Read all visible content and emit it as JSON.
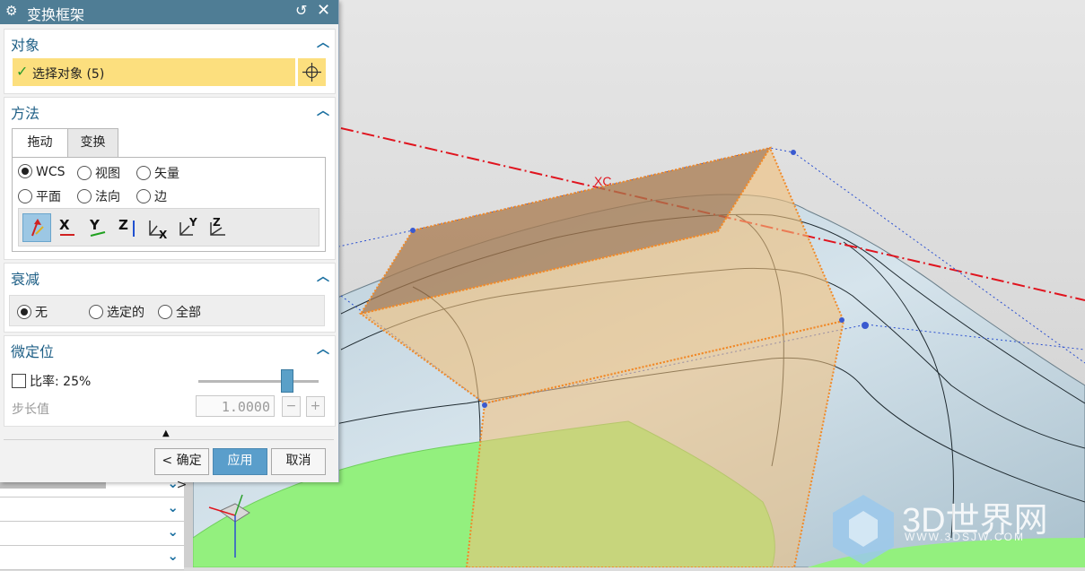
{
  "dialog": {
    "title": "变换框架",
    "sections": {
      "object": {
        "title": "对象",
        "select_label": "选择对象 (5)"
      },
      "method": {
        "title": "方法",
        "tabs": [
          "拖动",
          "变换"
        ],
        "active_tab": "拖动",
        "options_row1": [
          "WCS",
          "视图",
          "矢量"
        ],
        "options_row2": [
          "平面",
          "法向",
          "边"
        ],
        "selected_option": "WCS",
        "axis_buttons": [
          "X",
          "Y",
          "Z"
        ]
      },
      "attenuation": {
        "title": "衰减",
        "options": [
          "无",
          "选定的",
          "全部"
        ],
        "selected": "无"
      },
      "fine_positioning": {
        "title": "微定位",
        "ratio_label": "比率:",
        "ratio_value": "25%",
        "ratio_fraction": 0.73,
        "step_label": "步长值",
        "step_value": "1.0000",
        "minus_label": "−",
        "plus_label": "+"
      }
    },
    "buttons": {
      "ok": "< 确定 >",
      "apply": "应用",
      "cancel": "取消"
    }
  },
  "viewport": {
    "axis_label": "XC",
    "colors": {
      "axis_line": "#e0141e",
      "frame_fill": "#f0b060",
      "frame_edge": "#f08a2a",
      "surface": "#c6d8e2",
      "green_surface": "#8ff07a",
      "accent": "#4f7d95"
    }
  },
  "watermark": {
    "text": "3D世界网",
    "url": "WWW.3DSJW.COM"
  }
}
